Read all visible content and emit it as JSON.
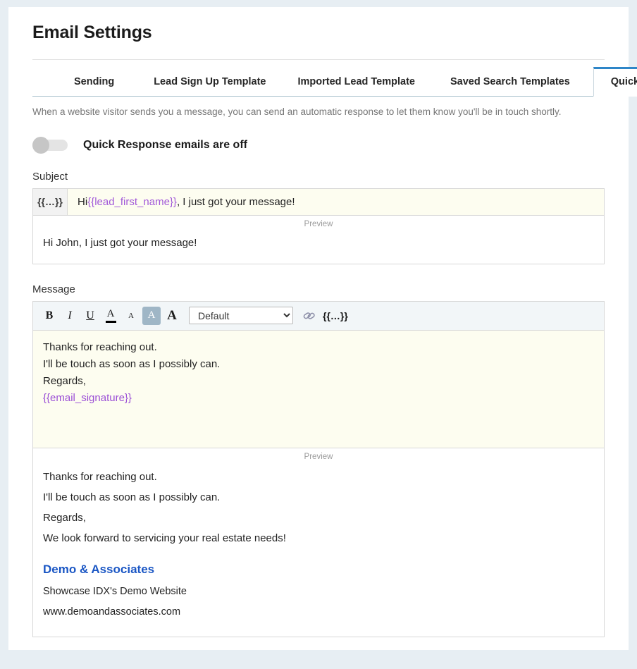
{
  "page": {
    "title": "Email Settings"
  },
  "tabs": [
    {
      "label": "Sending",
      "active": false
    },
    {
      "label": "Lead Sign Up Template",
      "active": false
    },
    {
      "label": "Imported Lead Template",
      "active": false
    },
    {
      "label": "Saved Search Templates",
      "active": false
    },
    {
      "label": "Quick Responses",
      "active": true
    }
  ],
  "intro": "When a website visitor sends you a message, you can send an automatic response to let them know you'll be in touch shortly.",
  "toggle": {
    "label": "Quick Response emails are off",
    "state": "off"
  },
  "subject": {
    "field_label": "Subject",
    "token_button": "{{…}}",
    "value_prefix": "Hi ",
    "value_token": "{{lead_first_name}}",
    "value_suffix": ", I just got your message!",
    "preview_label": "Preview",
    "preview_text": "Hi John, I just got your message!"
  },
  "message": {
    "field_label": "Message",
    "toolbar": {
      "bold": "B",
      "italic": "I",
      "underline": "U",
      "text_color": "A",
      "font_small": "A",
      "highlight": "A",
      "font_large": "A",
      "font_select_value": "Default",
      "font_select_options": [
        "Default"
      ],
      "link": "link-icon",
      "token_button": "{{…}}"
    },
    "body_lines": [
      "Thanks for reaching out.",
      "I'll be touch as soon as I possibly can.",
      "Regards,"
    ],
    "body_token": "{{email_signature}}",
    "preview_label": "Preview",
    "preview_lines": [
      "Thanks for reaching out.",
      "I'll be touch as soon as I possibly can.",
      "Regards,",
      "We look forward to servicing your real estate needs!"
    ],
    "signature": {
      "name": "Demo & Associates",
      "tagline": "Showcase IDX's Demo Website",
      "website": "www.demoandassociates.com"
    }
  },
  "colors": {
    "page_background": "#e7eef3",
    "accent_blue": "#2e86c8",
    "link_blue": "#1a56c4",
    "merge_token_purple": "#a259d9",
    "editor_background": "#fdfdf0",
    "highlight_button": "#9fb6c6"
  }
}
